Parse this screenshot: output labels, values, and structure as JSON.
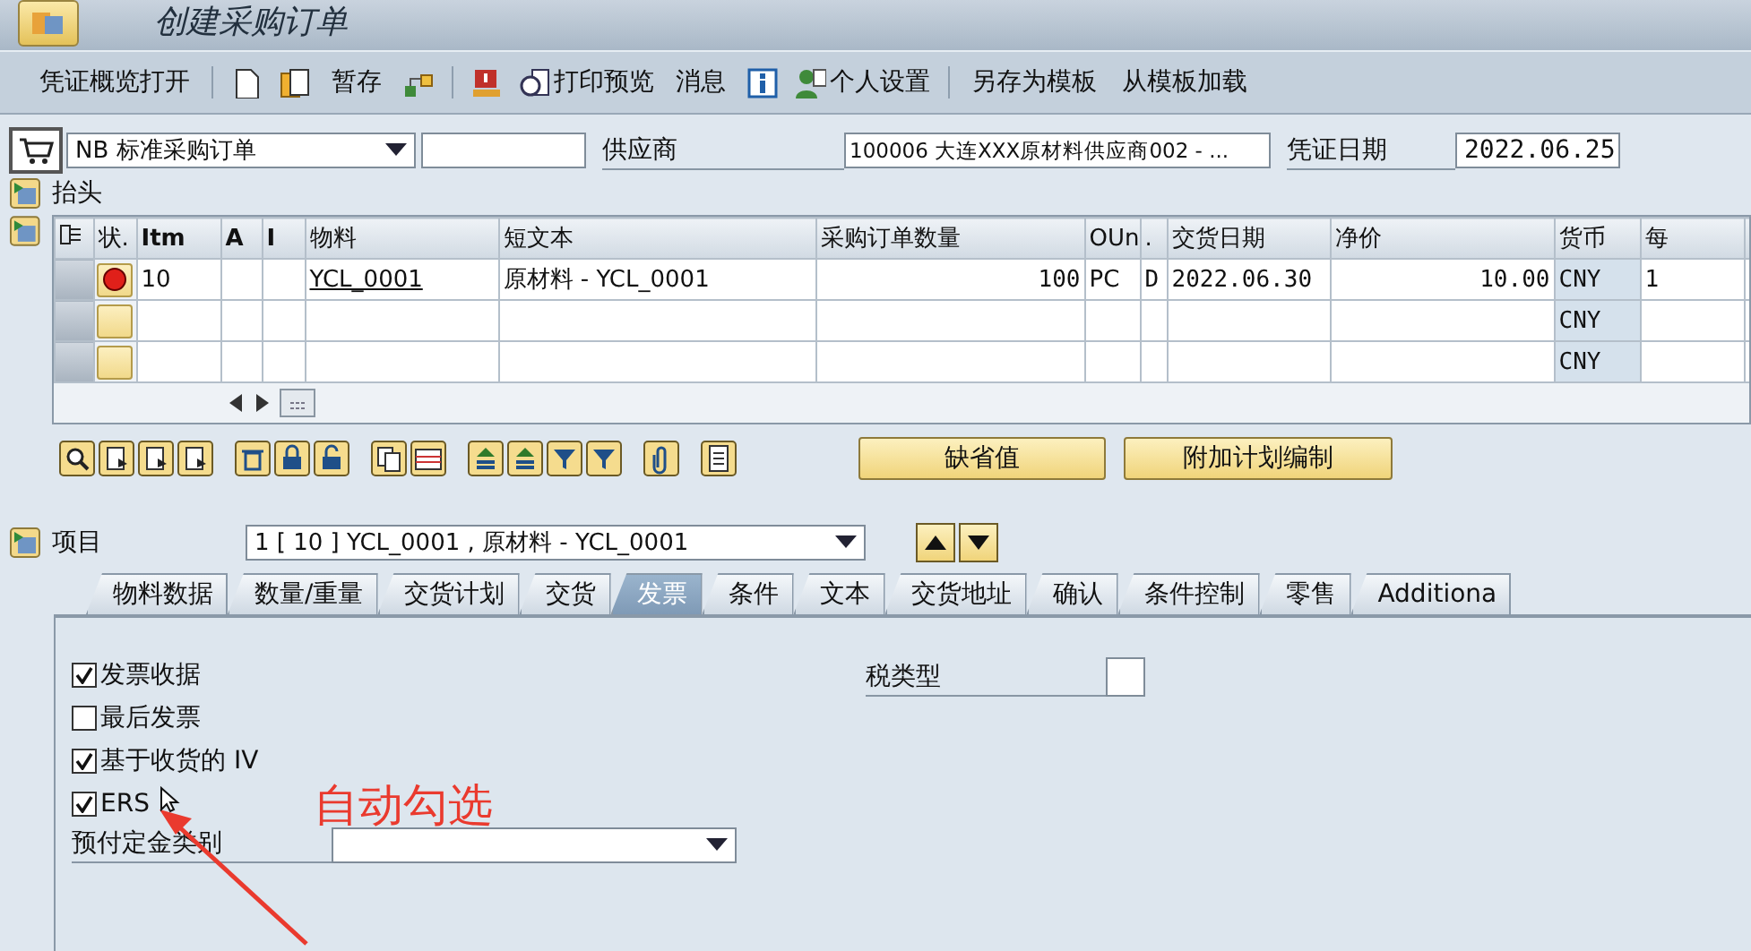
{
  "window": {
    "title": "创建采购订单"
  },
  "toolbar": [
    {
      "kind": "text",
      "label": "凭证概览打开"
    },
    {
      "kind": "separator"
    },
    {
      "kind": "icon"
    },
    {
      "kind": "icon"
    },
    {
      "kind": "text",
      "label": "暂存"
    },
    {
      "kind": "icon"
    },
    {
      "kind": "separator"
    },
    {
      "kind": "icon"
    },
    {
      "kind": "icon_text",
      "label": "打印预览"
    },
    {
      "kind": "text",
      "label": "消息"
    },
    {
      "kind": "icon"
    },
    {
      "kind": "icon_text",
      "label": "个人设置"
    },
    {
      "kind": "separator"
    },
    {
      "kind": "text",
      "label": "另存为模板"
    },
    {
      "kind": "text",
      "label": "从模板加载"
    }
  ],
  "header": {
    "order_type": "NB 标准采购订单",
    "vendor_label": "供应商",
    "vendor": "100006 大连XXX原材料供应商002 - ...",
    "date_label": "凭证日期",
    "date": "2022.06.25"
  },
  "header_section": {
    "label": "抬头"
  },
  "items_table": {
    "columns": [
      "状.",
      "Itm",
      "A",
      "I",
      "物料",
      "短文本",
      "采购订单数量",
      "OUn",
      ".",
      "交货日期",
      "净价",
      "货币",
      "每"
    ],
    "rows": [
      {
        "error": true,
        "item": "10",
        "material": "YCL_0001",
        "short_text": "原材料 - YCL_0001",
        "quantity": "100",
        "unit": "PC",
        "column_9": "D",
        "delivery_date": "2022.06.30",
        "net_price": "10.00",
        "currency": "CNY",
        "per": "1"
      },
      {
        "error": false,
        "currency": "CNY"
      },
      {
        "error": false,
        "currency": "CNY"
      }
    ]
  },
  "buttons": [
    "缺省值",
    "附加计划编制"
  ],
  "item_selector": {
    "label": "项目",
    "value": "1 [ 10 ] YCL_0001 , 原材料 - YCL_0001"
  },
  "tabs": [
    {
      "label": "物料数据",
      "selected": false
    },
    {
      "label": "数量/重量",
      "selected": false
    },
    {
      "label": "交货计划",
      "selected": false
    },
    {
      "label": "交货",
      "selected": false
    },
    {
      "label": "发票",
      "selected": true
    },
    {
      "label": "条件",
      "selected": false
    },
    {
      "label": "文本",
      "selected": false
    },
    {
      "label": "交货地址",
      "selected": false
    },
    {
      "label": "确认",
      "selected": false
    },
    {
      "label": "条件控制",
      "selected": false
    },
    {
      "label": "零售",
      "selected": false
    },
    {
      "label": "Additiona",
      "selected": false
    }
  ],
  "invoice_tab": {
    "checkboxes": [
      {
        "label": "发票收据",
        "checked": true
      },
      {
        "label": "最后发票",
        "checked": false
      },
      {
        "label": "基于收货的 IV",
        "checked": true
      },
      {
        "label": "ERS",
        "checked": true
      }
    ],
    "down_payment": {
      "label": "预付定金类别"
    },
    "tax_type": {
      "label": "税类型"
    }
  },
  "annotation": {
    "text": "自动勾选"
  }
}
